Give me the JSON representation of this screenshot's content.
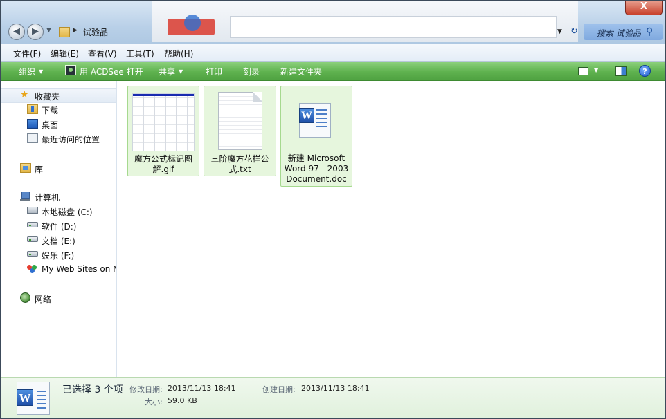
{
  "address": {
    "crumb": "试验品",
    "search_placeholder": "搜索 试验品"
  },
  "window": {
    "close_label": "X"
  },
  "menu": [
    "文件(F)",
    "编辑(E)",
    "查看(V)",
    "工具(T)",
    "帮助(H)"
  ],
  "toolbar": {
    "organize": "组织",
    "open_with": "用 ACDSee 打开",
    "share": "共享",
    "print": "打印",
    "burn": "刻录",
    "new_folder": "新建文件夹"
  },
  "nav": {
    "favorites": "收藏夹",
    "downloads": "下载",
    "desktop": "桌面",
    "recent": "最近访问的位置",
    "libraries": "库",
    "computer": "计算机",
    "drive_c": "本地磁盘 (C:)",
    "drive_d": "软件 (D:)",
    "drive_e": "文档 (E:)",
    "drive_f": "娱乐 (F:)",
    "msn": "My Web Sites on MSN",
    "network": "网络"
  },
  "files": [
    {
      "name": "魔方公式标记图\n解.gif",
      "type": "gif"
    },
    {
      "name": "三阶魔方花样公\n式.txt",
      "type": "txt"
    },
    {
      "name": "新建 Microsoft\nWord 97 - 2003\nDocument.doc",
      "type": "doc"
    }
  ],
  "details": {
    "selected": "已选择 3 个项",
    "modified_label": "修改日期:",
    "modified_value": "2013/11/13 18:41",
    "created_label": "创建日期:",
    "created_value": "2013/11/13 18:41",
    "size_label": "大小:",
    "size_value": "59.0 KB"
  },
  "icons": {
    "back": "back-arrow-icon",
    "forward": "forward-arrow-icon",
    "refresh": "refresh-icon",
    "search": "search-icon",
    "help": "help-icon"
  },
  "colors": {
    "toolbar_green": "#5fb24f",
    "selection_fill": "#e6f6dd",
    "selection_border": "#a6d98f"
  }
}
